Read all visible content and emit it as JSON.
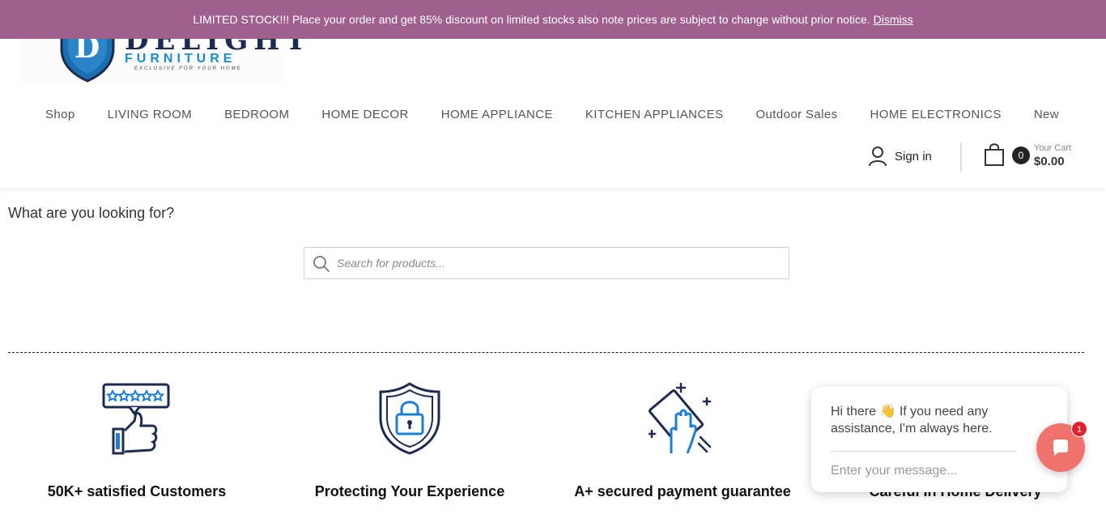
{
  "notice": {
    "text": "LIMITED STOCK!!! Place your order and get 85% discount on limited stocks also note prices are subject to change without prior notice.",
    "dismiss": "Dismiss"
  },
  "logo": {
    "letter": "D",
    "word1": "DELIGHT",
    "word2": "FURNITURE",
    "tagline": "EXCLUSIVE FOR YOUR HOME"
  },
  "nav": {
    "items": [
      "Shop",
      "LIVING ROOM",
      "BEDROOM",
      "HOME DECOR",
      "HOME APPLIANCE",
      "KITCHEN APPLIANCES",
      "Outdoor Sales",
      "HOME ELECTRONICS",
      "New"
    ]
  },
  "account": {
    "sign_in": "Sign in"
  },
  "cart": {
    "count": "0",
    "title": "Your Cart",
    "total": "$0.00"
  },
  "search": {
    "heading": "What are you looking for?",
    "placeholder": "Search for products..."
  },
  "features": [
    {
      "title": "50K+ satisfied Customers",
      "icon": "review-thumbs-up-icon"
    },
    {
      "title": "Protecting Your Experience",
      "icon": "shield-lock-icon"
    },
    {
      "title": "A+ secured payment guarantee",
      "icon": "clean-hand-icon"
    },
    {
      "title": "Careful In Home Delivery",
      "icon": "delivery-icon"
    }
  ],
  "chat": {
    "greeting": "Hi there 👋 If you need any assistance, I'm always here.",
    "placeholder": "Enter your message...",
    "badge": "1"
  },
  "colors": {
    "notice_bg": "#a0608f",
    "chat_button": "#f0736b",
    "icon_navy": "#1d2b4f",
    "icon_blue": "#1b7fd8"
  }
}
